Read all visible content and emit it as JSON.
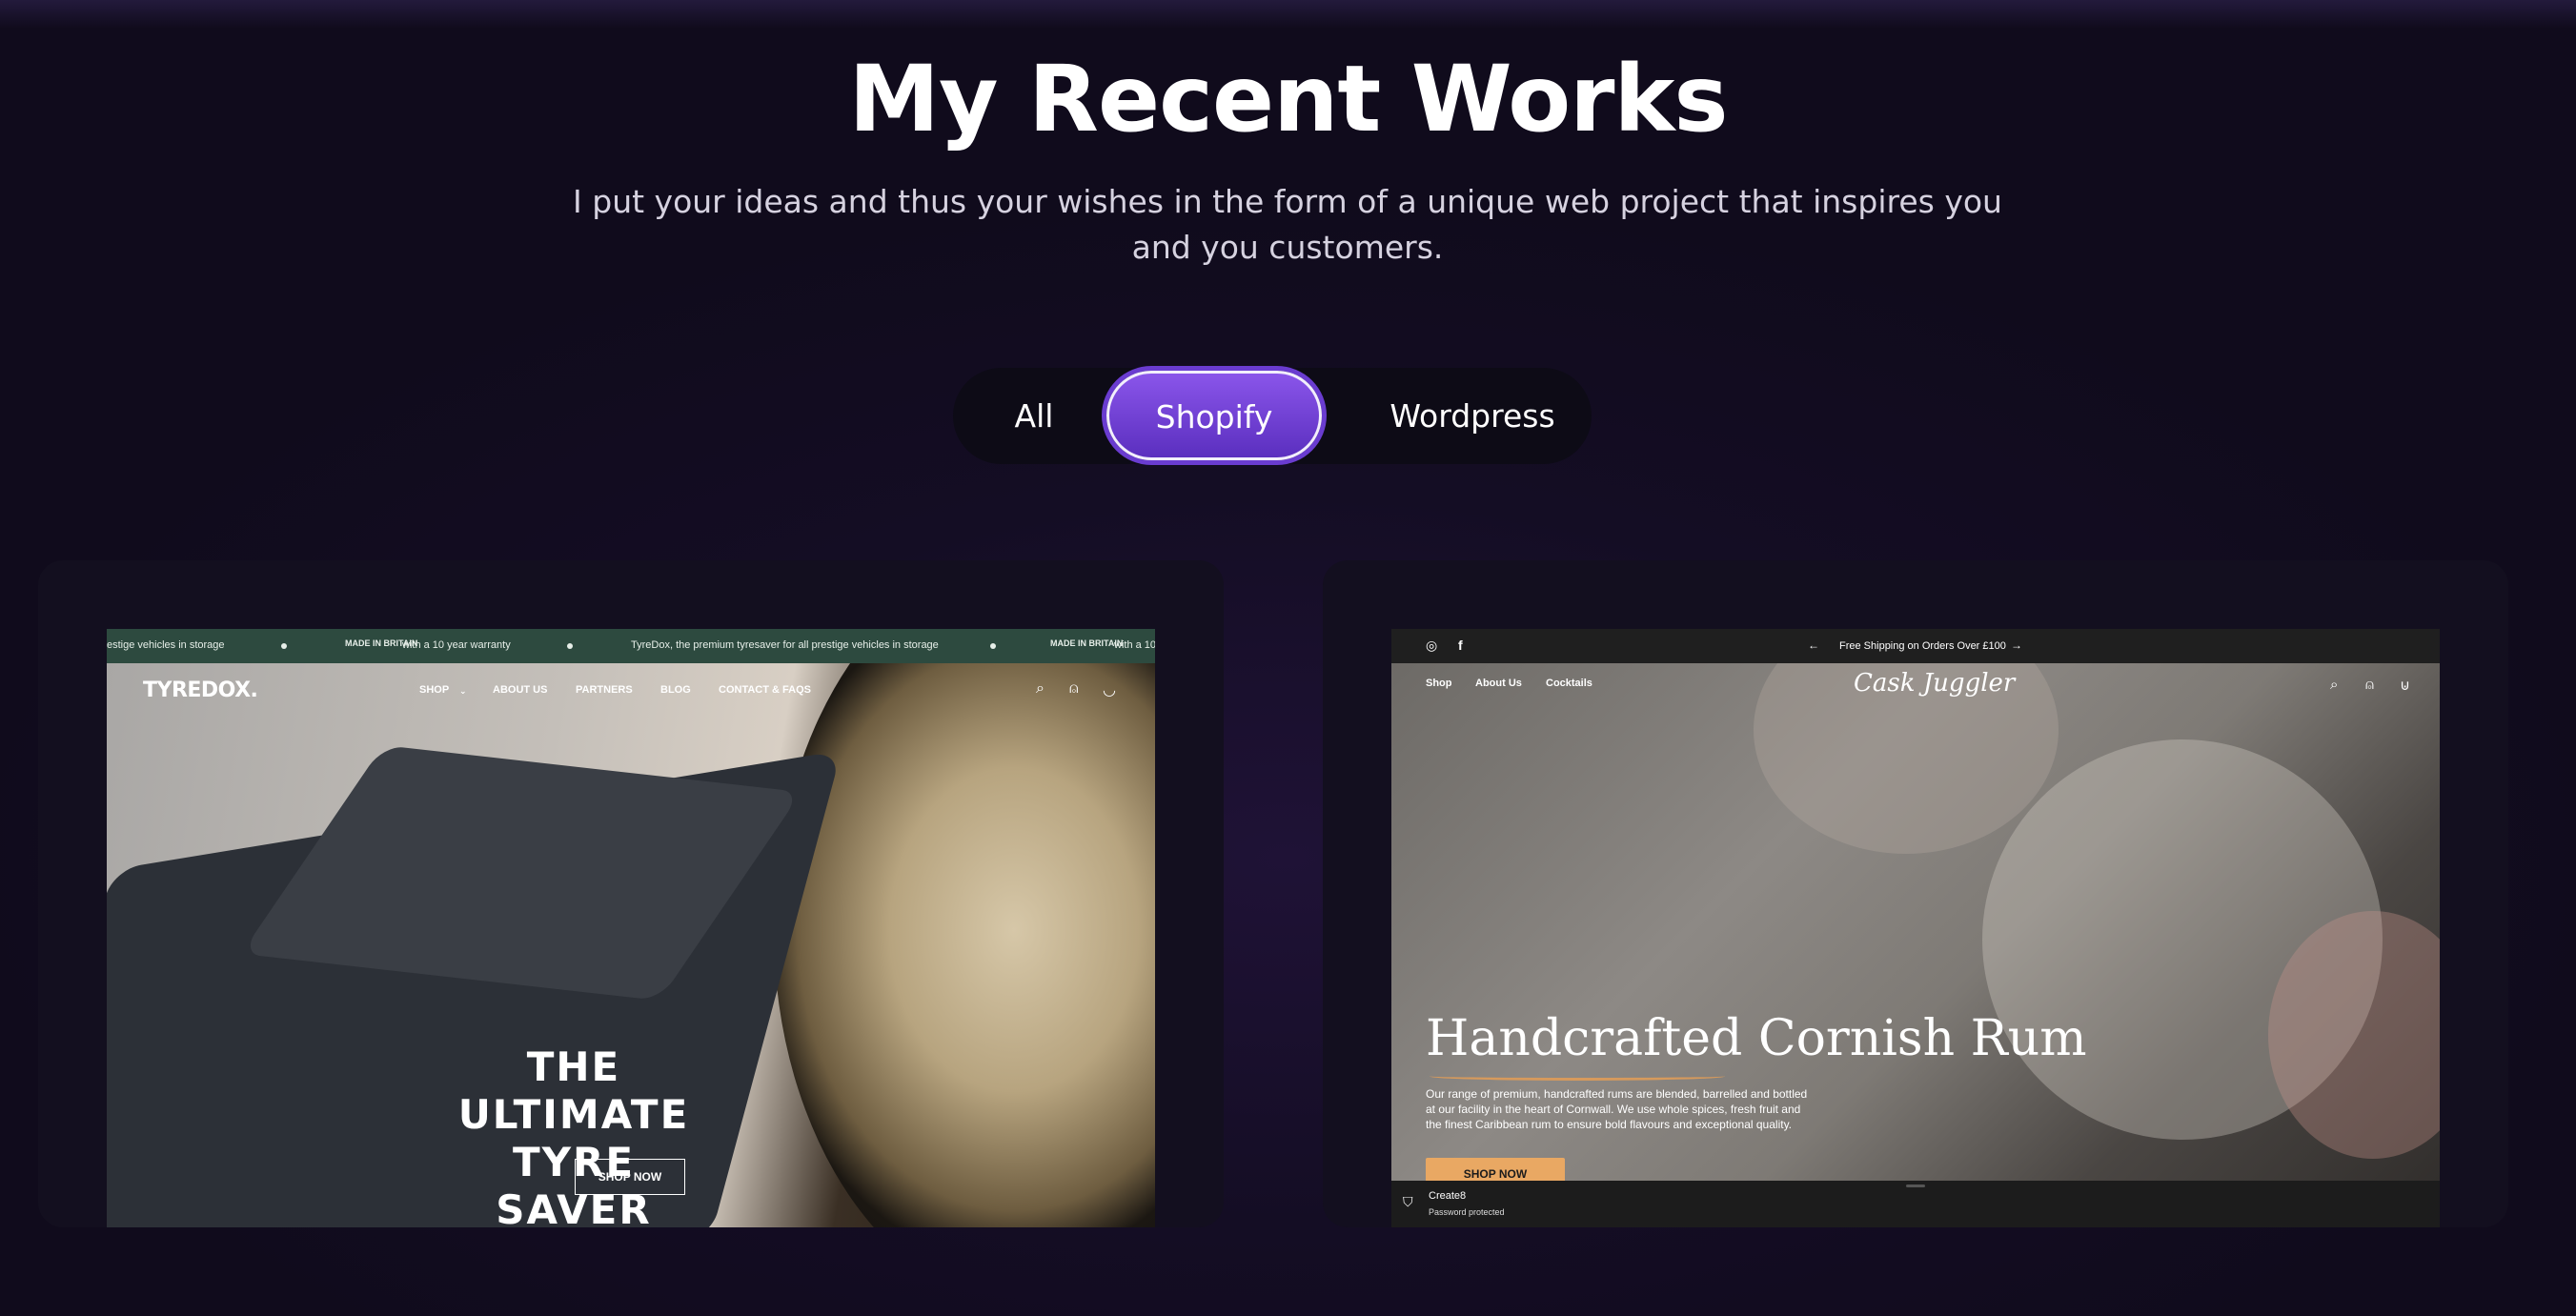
{
  "header": {
    "title": "My Recent Works",
    "subtitle": "I put your ideas and thus your wishes in the form of a unique web project that inspires you and you customers."
  },
  "filter": {
    "tabs": [
      {
        "label": "All",
        "selected": false
      },
      {
        "label": "Shopify",
        "selected": true
      },
      {
        "label": "Wordpress",
        "selected": false
      }
    ]
  },
  "colors": {
    "background": "#140d24",
    "accent": "#7a45e0",
    "card": "#130f1f"
  },
  "projects": [
    {
      "announcement": {
        "items": [
          "estige vehicles in storage",
          "with a 10 year warranty",
          "TyreDox, the premium tyresaver for all prestige vehicles in storage",
          "with a 10"
        ],
        "badge": "MADE IN BRITAIN"
      },
      "logo": "TYREDOX.",
      "nav": [
        "SHOP",
        "ABOUT US",
        "PARTNERS",
        "BLOG",
        "CONTACT & FAQS"
      ],
      "headline": "THE ULTIMATE TYRE SAVER",
      "cta": "SHOP NOW"
    },
    {
      "announcement": {
        "text": "Free Shipping on Orders Over £100"
      },
      "logo": "Cask Juggler",
      "nav": [
        "Shop",
        "About Us",
        "Cocktails"
      ],
      "headline": "Handcrafted Cornish Rum",
      "body": "Our range of premium, handcrafted rums are blended, barrelled and bottled at our facility in the heart of Cornwall. We use whole spices, fresh fruit and the finest Caribbean rum to ensure bold flavours and exceptional quality.",
      "cta": "SHOP NOW",
      "footer": {
        "store": "Create8",
        "status": "Password protected"
      }
    }
  ]
}
